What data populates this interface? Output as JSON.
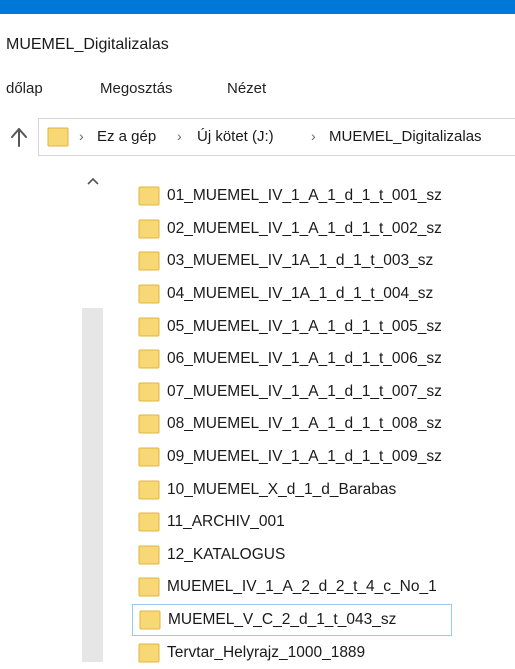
{
  "window": {
    "title": "MUEMEL_Digitalizalas"
  },
  "ribbon": {
    "tabs": [
      "dőlap",
      "Megosztás",
      "Nézet"
    ]
  },
  "address_bar": {
    "crumbs": [
      "Ez a gép",
      "Új kötet (J:)",
      "MUEMEL_Digitalizalas"
    ],
    "separator": "›"
  },
  "icons": {
    "back": "up-arrow-icon",
    "folder": "folder-icon",
    "scroll_up": "chevron-up-icon"
  },
  "colors": {
    "title_bar": "#0078d7",
    "folder_fill": "#f8d775",
    "folder_dark": "#e2b53e",
    "selection_border": "#99c9f0"
  },
  "files": [
    "01_MUEMEL_IV_1_A_1_d_1_t_001_sz",
    "02_MUEMEL_IV_1_A_1_d_1_t_002_sz",
    "03_MUEMEL_IV_1A_1_d_1_t_003_sz",
    "04_MUEMEL_IV_1A_1_d_1_t_004_sz",
    "05_MUEMEL_IV_1_A_1_d_1_t_005_sz",
    "06_MUEMEL_IV_1_A_1_d_1_t_006_sz",
    "07_MUEMEL_IV_1_A_1_d_1_t_007_sz",
    "08_MUEMEL_IV_1_A_1_d_1_t_008_sz",
    "09_MUEMEL_IV_1_A_1_d_1_t_009_sz",
    "10_MUEMEL_X_d_1_d_Barabas",
    "11_ARCHIV_001",
    "12_KATALOGUS",
    "MUEMEL_IV_1_A_2_d_2_t_4_c_No_1",
    "MUEMEL_V_C_2_d_1_t_043_sz",
    "Tervtar_Helyrajz_1000_1889"
  ]
}
